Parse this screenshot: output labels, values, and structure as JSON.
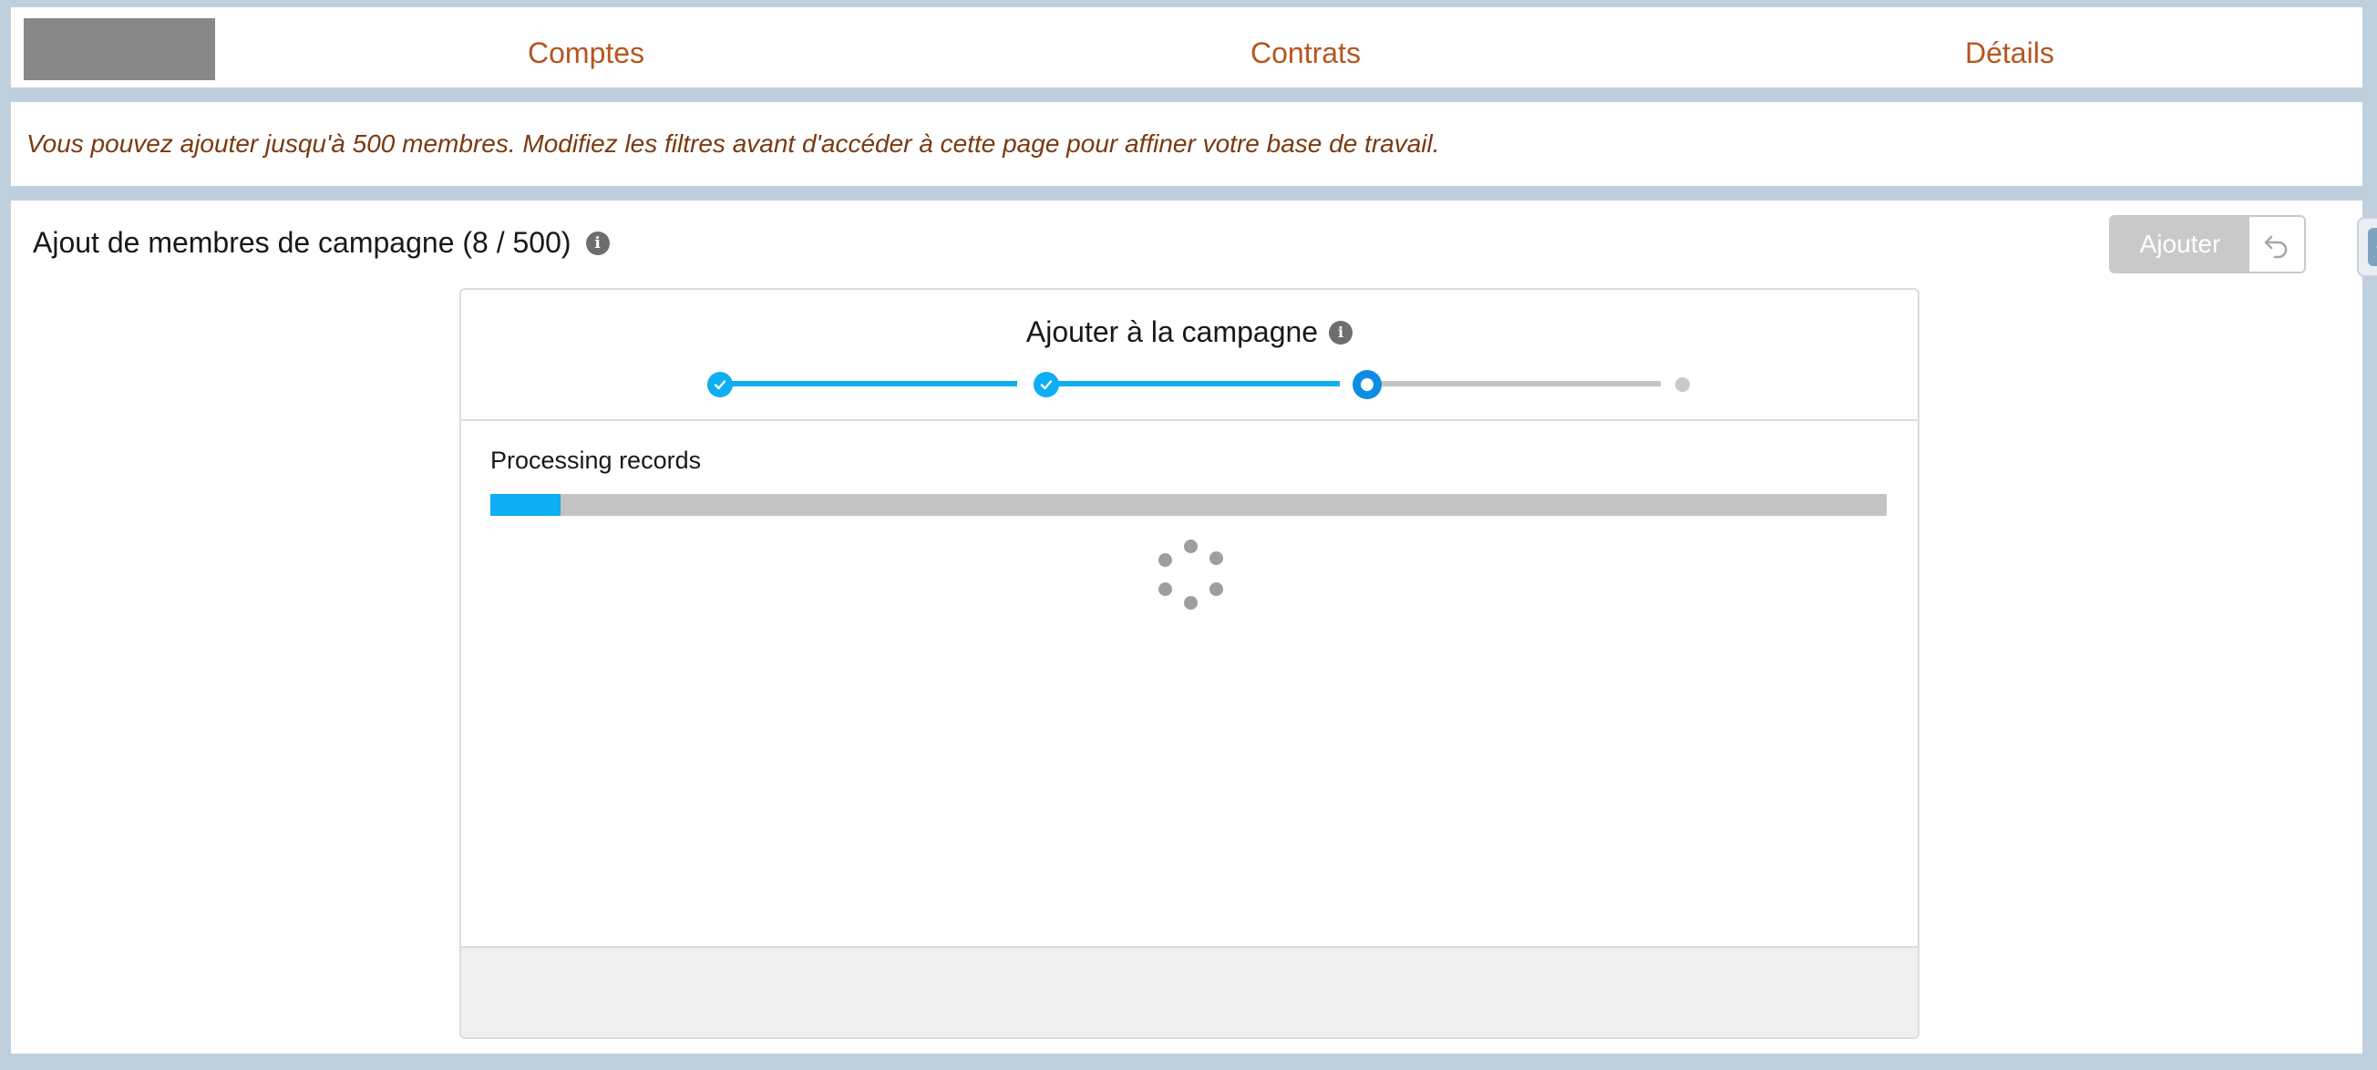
{
  "nav": {
    "links": [
      "Comptes",
      "Contrats",
      "Détails"
    ]
  },
  "banner": {
    "message": "Vous pouvez ajouter jusqu'à 500 membres. Modifiez les filtres avant d'accéder à cette page pour affiner votre base de travail."
  },
  "main": {
    "title": "Ajout de membres de campagne (8 / 500)",
    "add_button": "Ajouter"
  },
  "card": {
    "title": "Ajouter à la campagne",
    "steps": [
      "complete",
      "complete",
      "current",
      "pending"
    ],
    "processing_label": "Processing records",
    "progress_fraction": 0.05
  },
  "colors": {
    "accent": "#0daef2",
    "nav_link": "#b5561f",
    "banner_text": "#7a3a10",
    "page_background": "#bfcfde"
  },
  "icons": {
    "info": "info-icon",
    "undo": "undo-icon",
    "step_done": "check-icon",
    "spinner": "loading-spinner-icon",
    "side_tab": "chevron-left-icon"
  }
}
